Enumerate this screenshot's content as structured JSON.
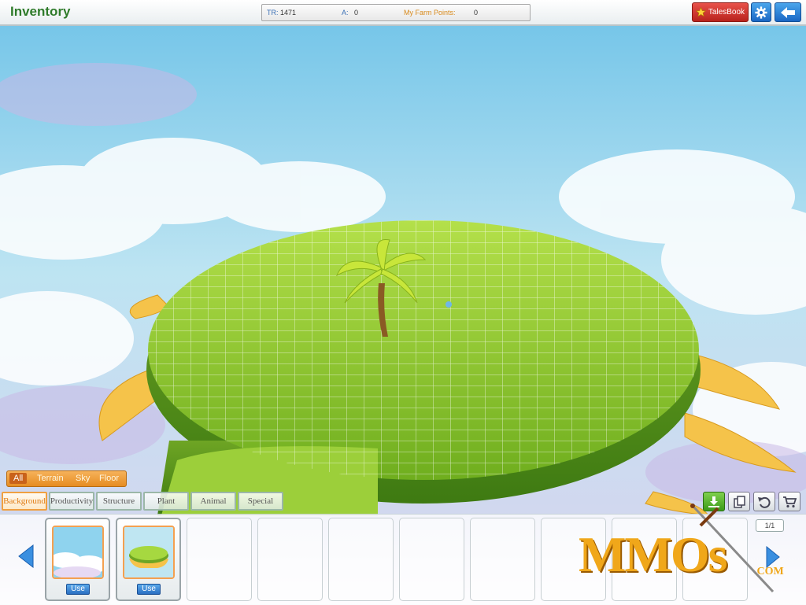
{
  "header": {
    "title": "Inventory",
    "stats": {
      "tr_label": "TR:",
      "tr_value": "1471",
      "a_label": "A:",
      "a_value": "0",
      "points_label": "My Farm Points:",
      "points_value": "0"
    },
    "talesbook_label": "TalesBook"
  },
  "filters": {
    "primary": [
      "All",
      "Terrain",
      "Sky",
      "Floor"
    ],
    "categories": [
      "Background",
      "Productivity",
      "Structure",
      "Plant",
      "Animal",
      "Special"
    ]
  },
  "inventory": {
    "items": [
      {
        "use_label": "Use"
      },
      {
        "use_label": "Use"
      }
    ],
    "page": "1/1"
  },
  "watermark": {
    "brand": "MMOs",
    "suffix": ".COM"
  },
  "colors": {
    "accent_orange": "#e68c22",
    "title_green": "#2f7b2a",
    "button_blue": "#1b67c4",
    "talesbook_red": "#c52a22"
  },
  "icons": [
    "star-icon",
    "gear-icon",
    "back-arrow-icon",
    "download-icon",
    "copy-icon",
    "undo-icon",
    "cart-icon",
    "left-arrow-icon",
    "right-arrow-icon"
  ]
}
